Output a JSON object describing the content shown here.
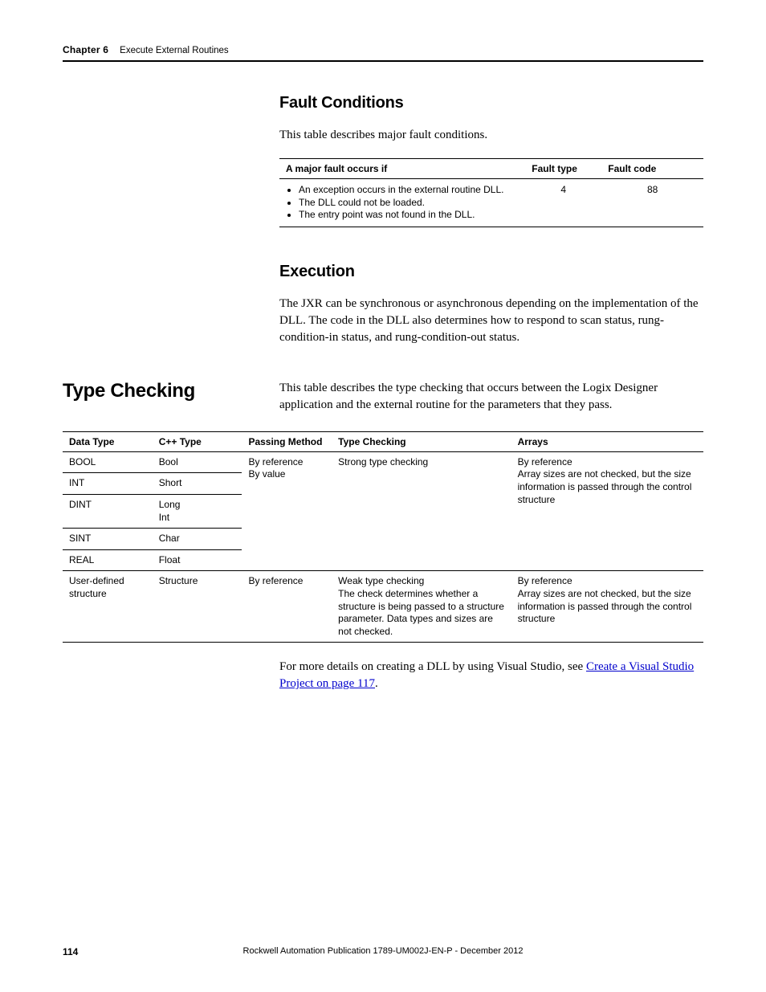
{
  "header": {
    "chapter_label": "Chapter 6",
    "chapter_title": "Execute External Routines"
  },
  "fault_section": {
    "heading": "Fault Conditions",
    "intro": "This table describes major fault conditions.",
    "columns": {
      "cond": "A major fault occurs if",
      "type": "Fault type",
      "code": "Fault code"
    },
    "row": {
      "bullets": [
        "An exception occurs in the external routine DLL.",
        "The DLL could not be loaded.",
        "The entry point was not found in the DLL."
      ],
      "type": "4",
      "code": "88"
    }
  },
  "execution_section": {
    "heading": "Execution",
    "body": "The JXR can be synchronous or asynchronous depending on the implementation of the DLL. The code in the DLL also determines how to respond to scan status, rung-condition-in status, and rung-condition-out status."
  },
  "typecheck_section": {
    "side_heading": "Type Checking",
    "intro": "This table describes the type checking that occurs between the Logix Designer application and the external routine for the parameters that they pass.",
    "columns": {
      "dt": "Data Type",
      "ct": "C++ Type",
      "pm": "Passing Method",
      "tc": "Type Checking",
      "ar": "Arrays"
    },
    "group1": {
      "pm_line1": "By reference",
      "pm_line2": "By value",
      "tc": "Strong type checking",
      "ar_line1": "By reference",
      "ar_rest": "Array sizes are not checked, but the size information is passed through the control structure",
      "rows": [
        {
          "dt": "BOOL",
          "ct": "Bool"
        },
        {
          "dt": "INT",
          "ct": "Short"
        },
        {
          "dt": "DINT",
          "ct": "Long\nInt"
        },
        {
          "dt": "SINT",
          "ct": "Char"
        },
        {
          "dt": "REAL",
          "ct": "Float"
        }
      ]
    },
    "group2": {
      "dt": "User-defined structure",
      "ct": "Structure",
      "pm": "By reference",
      "tc_line1": "Weak type checking",
      "tc_rest": "The check determines whether a structure is being passed to a structure parameter. Data types and sizes are not checked.",
      "ar_line1": "By reference",
      "ar_rest": "Array sizes are not checked, but the size information is passed through the control structure"
    }
  },
  "closing": {
    "prefix": "For more details on creating a DLL by using Visual Studio, see ",
    "link": "Create a Visual Studio Project on page 117",
    "suffix": "."
  },
  "footer": {
    "page": "114",
    "pub": "Rockwell Automation Publication 1789-UM002J-EN-P - December 2012"
  }
}
